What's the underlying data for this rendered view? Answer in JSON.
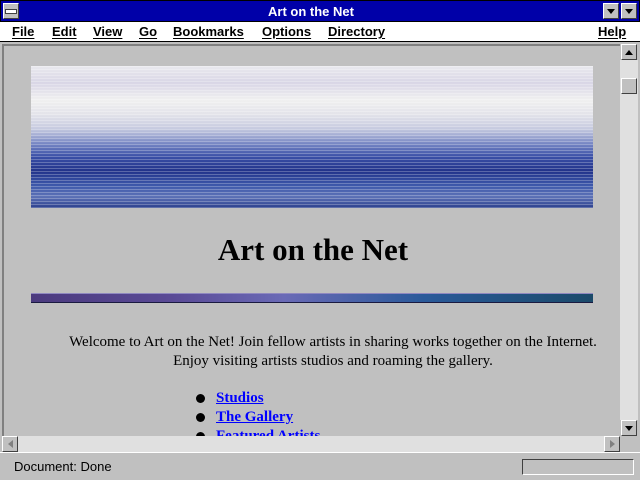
{
  "window": {
    "title": "Art on the Net"
  },
  "menu": {
    "items": [
      "File",
      "Edit",
      "View",
      "Go",
      "Bookmarks",
      "Options",
      "Directory"
    ],
    "help": "Help"
  },
  "page": {
    "heading": "Art on the Net",
    "welcome_line1": "Welcome to Art on the Net! Join fellow artists in sharing works together on the Internet.",
    "welcome_line2": "Enjoy visiting artists studios and roaming the gallery.",
    "links": [
      "Studios",
      "The Gallery",
      "Featured Artists"
    ],
    "link_color": "#0000ff"
  },
  "status": {
    "text": "Document: Done"
  },
  "colors": {
    "titlebar": "#0000a8",
    "chrome": "#c0c0c0"
  }
}
